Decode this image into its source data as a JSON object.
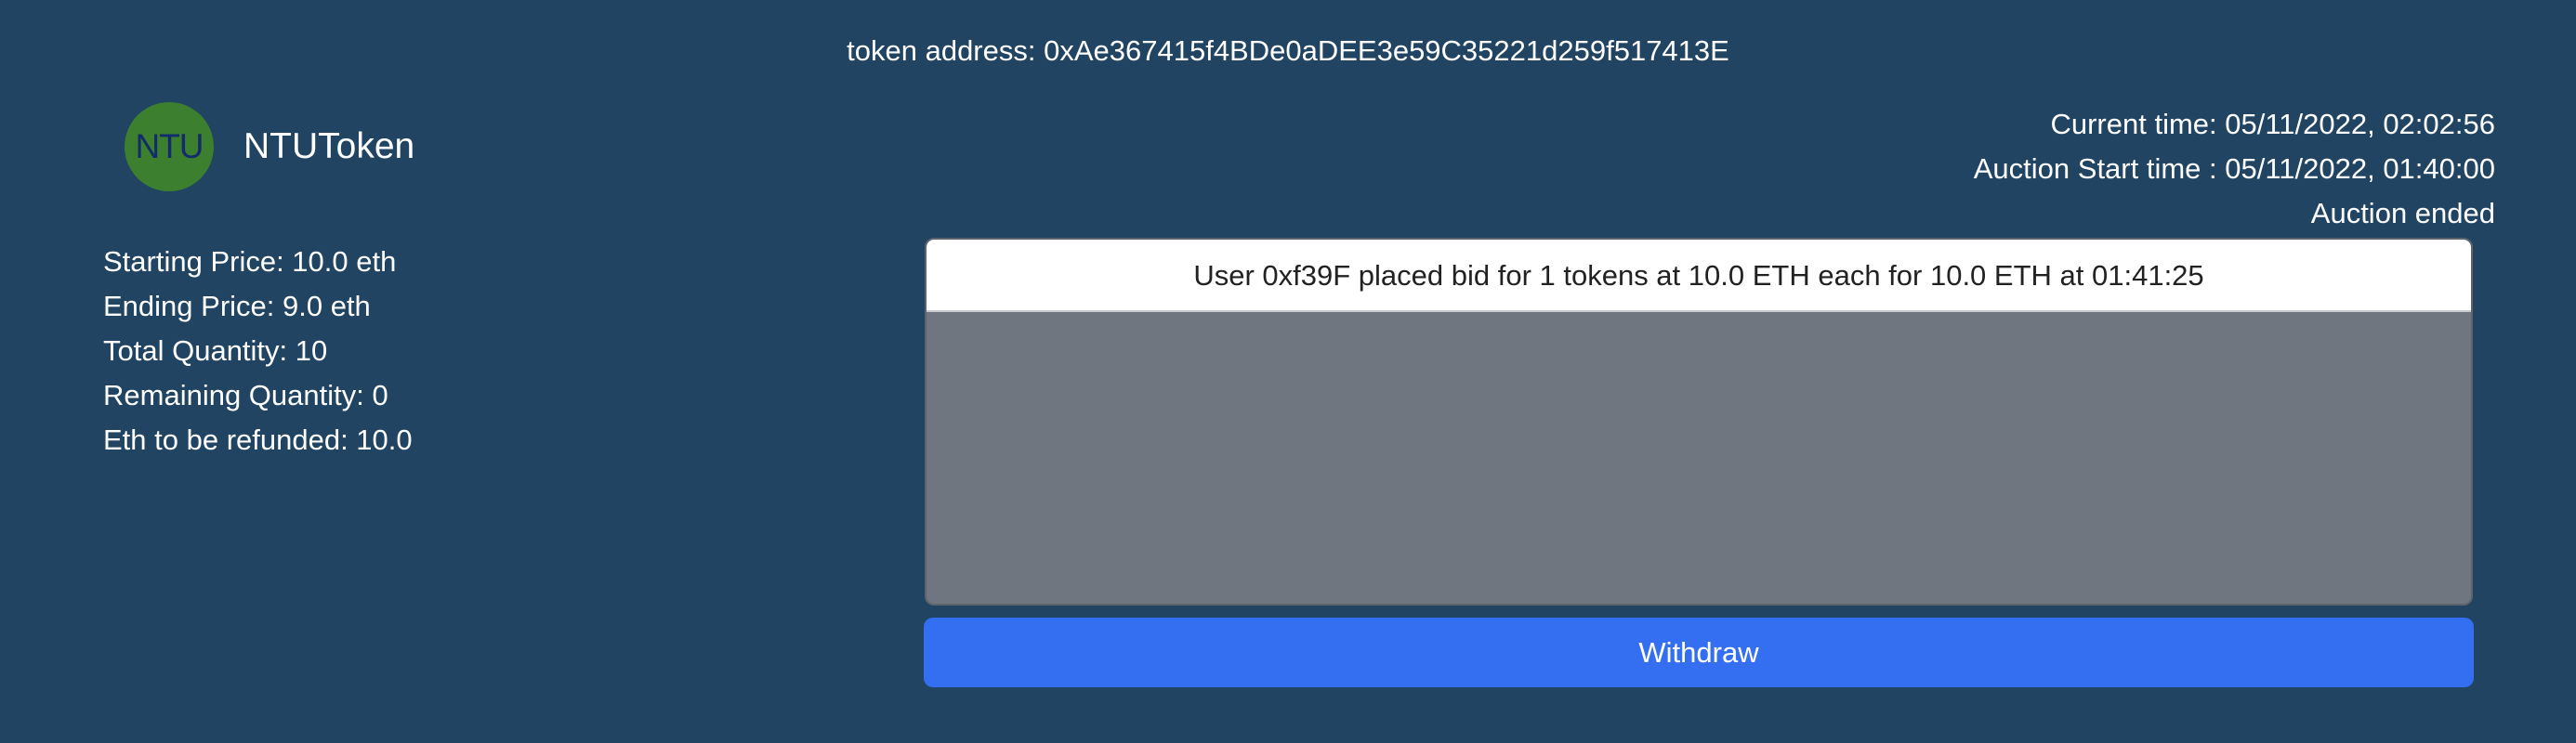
{
  "header": {
    "token_address": "token address: 0xAe367415f4BDe0aDEE3e59C35221d259f517413E"
  },
  "token": {
    "logo_text": "NTU",
    "name": "NTUToken",
    "logo_color": "#3b7f2f"
  },
  "info": {
    "starting_price": "Starting Price: 10.0 eth",
    "ending_price": "Ending Price: 9.0 eth",
    "total_quantity": "Total Quantity: 10",
    "remaining_quantity": "Remaining Quantity: 0",
    "eth_refund": "Eth to be refunded: 10.0"
  },
  "auction": {
    "current_time": "Current time: 05/11/2022, 02:02:56",
    "start_time": "Auction Start time : 05/11/2022, 01:40:00",
    "status": "Auction ended"
  },
  "bids": [
    "User 0xf39F placed bid for 1 tokens at 10.0 ETH each for 10.0 ETH at 01:41:25"
  ],
  "actions": {
    "withdraw_label": "Withdraw"
  },
  "colors": {
    "background": "#204462",
    "panel": "#6f7680",
    "button": "#346ff2"
  }
}
